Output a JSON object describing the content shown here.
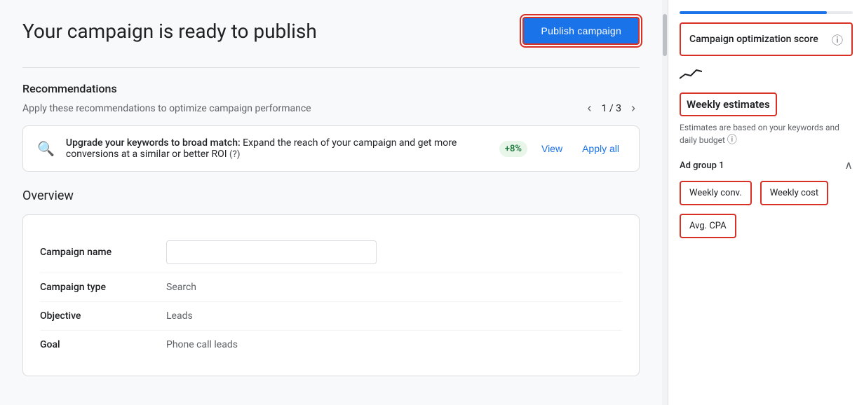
{
  "page": {
    "title": "Your campaign is ready to publish"
  },
  "header": {
    "publish_button_label": "Publish campaign"
  },
  "recommendations": {
    "section_title": "Recommendations",
    "subtitle": "Apply these recommendations to optimize campaign performance",
    "pagination": {
      "current": 1,
      "total": 3,
      "display": "1 / 3"
    },
    "card": {
      "icon": "🔍",
      "title": "Upgrade your keywords to broad match:",
      "description": "Expand the reach of your campaign and get more conversions at a similar or better ROI",
      "badge": "+8%",
      "view_label": "View",
      "apply_label": "Apply all",
      "help_icon": "?"
    }
  },
  "overview": {
    "section_title": "Overview",
    "fields": [
      {
        "label": "Campaign name",
        "value": "",
        "type": "input",
        "placeholder": ""
      },
      {
        "label": "Campaign type",
        "value": "Search",
        "type": "text"
      },
      {
        "label": "Objective",
        "value": "Leads",
        "type": "text"
      },
      {
        "label": "Goal",
        "value": "Phone call leads",
        "type": "text"
      }
    ]
  },
  "sidebar": {
    "progress_percent": 85,
    "optimization_score": {
      "label": "Campaign optimization score",
      "help_icon": "?"
    },
    "weekly_estimates": {
      "title": "Weekly estimates",
      "subtitle": "Estimates are based on your keywords and daily budget",
      "help_icon": "?"
    },
    "ad_group": {
      "label": "Ad group 1",
      "collapse_icon": "^"
    },
    "metrics": [
      {
        "label": "Weekly conv."
      },
      {
        "label": "Weekly cost"
      }
    ],
    "metric_single": {
      "label": "Avg. CPA"
    }
  }
}
